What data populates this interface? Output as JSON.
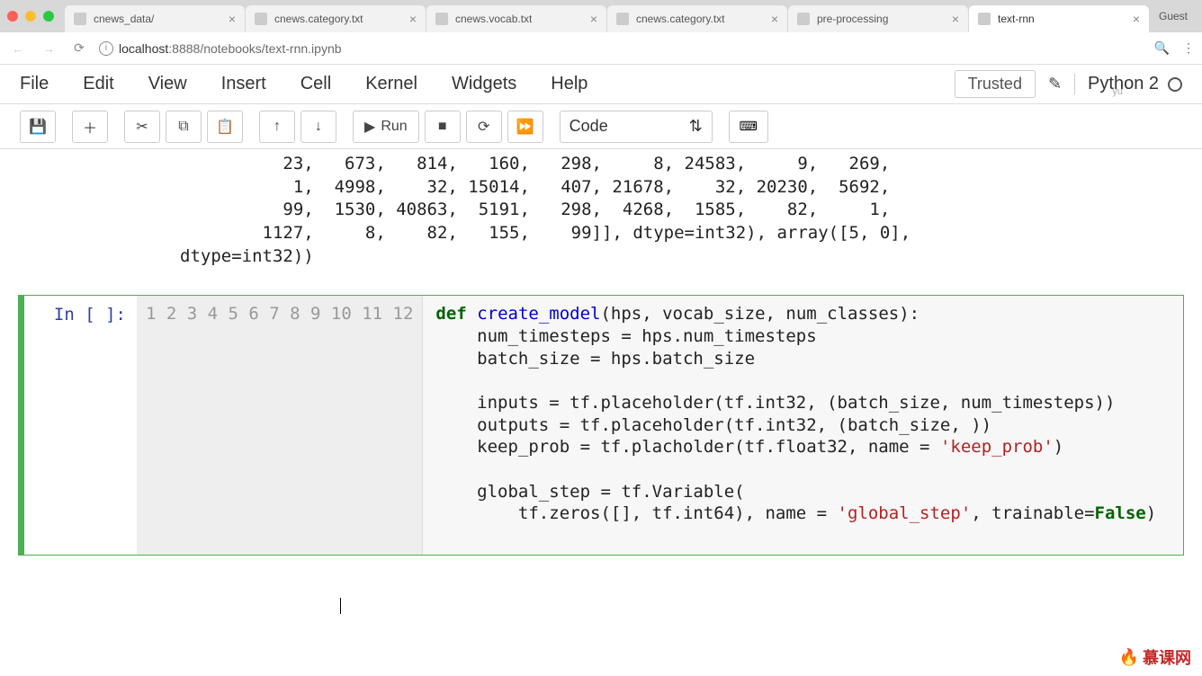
{
  "browser": {
    "guest_label": "Guest",
    "tabs": [
      {
        "title": "cnews_data/",
        "active": false
      },
      {
        "title": "cnews.category.txt",
        "active": false
      },
      {
        "title": "cnews.vocab.txt",
        "active": false
      },
      {
        "title": "cnews.category.txt",
        "active": false
      },
      {
        "title": "pre-processing",
        "active": false
      },
      {
        "title": "text-rnn",
        "active": true
      }
    ],
    "url_host": "localhost",
    "url_port": ":8888",
    "url_path": "/notebooks/text-rnn.ipynb"
  },
  "menubar": {
    "items": [
      "File",
      "Edit",
      "View",
      "Insert",
      "Cell",
      "Kernel",
      "Widgets",
      "Help"
    ],
    "trusted": "Trusted",
    "kernel": "Python 2",
    "yu": "yu"
  },
  "toolbar": {
    "run_label": "Run",
    "celltype": "Code"
  },
  "output_text": "          23,   673,   814,   160,   298,     8, 24583,     9,   269,\n           1,  4998,    32, 15014,   407, 21678,    32, 20230,  5692,\n          99,  1530, 40863,  5191,   298,  4268,  1585,    82,     1,\n        1127,     8,    82,   155,    99]], dtype=int32), array([5, 0],\ndtype=int32))",
  "code_cell": {
    "prompt": "In [ ]:",
    "line_numbers": [
      "1",
      "2",
      "3",
      "4",
      "5",
      "6",
      "7",
      "8",
      "9",
      "10",
      "11",
      "12"
    ],
    "code_plain": "def create_model(hps, vocab_size, num_classes):\n    num_timesteps = hps.num_timesteps\n    batch_size = hps.batch_size\n\n    inputs = tf.placeholder(tf.int32, (batch_size, num_timesteps))\n    outputs = tf.placeholder(tf.int32, (batch_size, ))\n    keep_prob = tf.placholder(tf.float32, name = 'keep_prob')\n\n    global_step = tf.Variable(\n        tf.zeros([], tf.int64), name = 'global_step', trainable=False)\n\n"
  },
  "watermark": "慕课网"
}
